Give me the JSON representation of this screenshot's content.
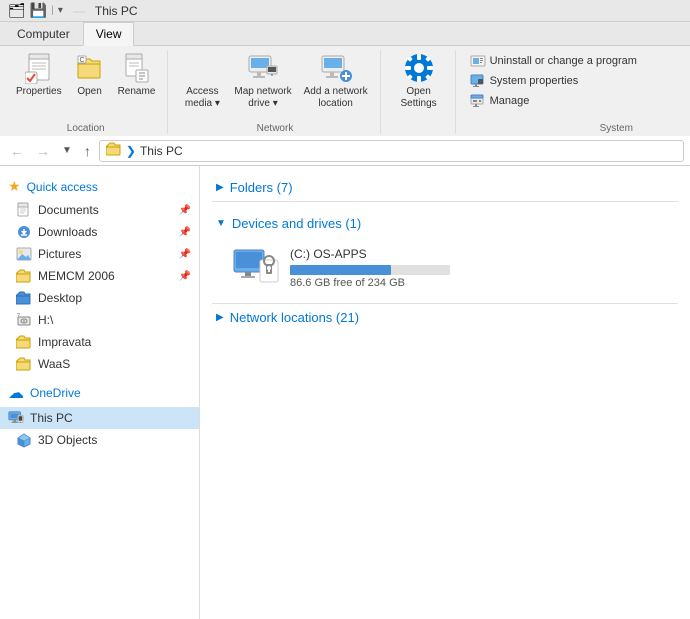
{
  "titleBar": {
    "title": "This PC",
    "icons": [
      "file-icon",
      "drive-icon"
    ]
  },
  "ribbon": {
    "tabs": [
      "Computer",
      "View"
    ],
    "activeTab": "Computer",
    "groups": {
      "location": {
        "label": "Location",
        "buttons": [
          {
            "id": "properties",
            "label": "Properties",
            "icon": "✔"
          },
          {
            "id": "open",
            "label": "Open",
            "icon": "📁"
          },
          {
            "id": "rename",
            "label": "Rename",
            "icon": "✏"
          }
        ]
      },
      "network": {
        "label": "Network",
        "buttons": [
          {
            "id": "access-media",
            "label": "Access\nmedia ▾",
            "icon": "💿"
          },
          {
            "id": "map-network-drive",
            "label": "Map network\ndrive ▾",
            "icon": "🖥"
          },
          {
            "id": "add-network-location",
            "label": "Add a network\nlocation",
            "icon": "🖥"
          }
        ]
      },
      "openSettings": {
        "label": "",
        "buttons": [
          {
            "id": "open-settings",
            "label": "Open\nSettings",
            "icon": "⚙"
          }
        ]
      },
      "system": {
        "label": "System",
        "items": [
          {
            "id": "uninstall",
            "label": "Uninstall or change a program",
            "icon": "📊"
          },
          {
            "id": "system-props",
            "label": "System properties",
            "icon": "🖥"
          },
          {
            "id": "manage",
            "label": "Manage",
            "icon": "🖥"
          }
        ]
      }
    }
  },
  "addressBar": {
    "backEnabled": false,
    "forwardEnabled": false,
    "upEnabled": true,
    "path": [
      "This PC"
    ]
  },
  "sidebar": {
    "sections": [
      {
        "id": "quick-access",
        "label": "Quick access",
        "icon": "⭐",
        "items": [
          {
            "id": "documents",
            "label": "Documents",
            "icon": "doc",
            "pinned": true
          },
          {
            "id": "downloads",
            "label": "Downloads",
            "icon": "dl",
            "pinned": true
          },
          {
            "id": "pictures",
            "label": "Pictures",
            "icon": "pic",
            "pinned": true
          },
          {
            "id": "memcm",
            "label": "MEMCM 2006",
            "icon": "folder",
            "pinned": true
          },
          {
            "id": "desktop",
            "label": "Desktop",
            "icon": "folder-blue"
          },
          {
            "id": "h-drive",
            "label": "H:\\",
            "icon": "h-drive"
          },
          {
            "id": "impravata",
            "label": "Impravata",
            "icon": "folder"
          },
          {
            "id": "waas",
            "label": "WaaS",
            "icon": "folder"
          }
        ]
      },
      {
        "id": "onedrive",
        "label": "OneDrive",
        "icon": "☁"
      },
      {
        "id": "this-pc",
        "label": "This PC",
        "icon": "pc",
        "selected": true
      },
      {
        "id": "3d-objects",
        "label": "3D Objects",
        "icon": "3d"
      }
    ]
  },
  "content": {
    "sections": [
      {
        "id": "folders",
        "title": "Folders (7)",
        "collapsed": true,
        "toggleIcon": "▶"
      },
      {
        "id": "devices",
        "title": "Devices and drives (1)",
        "collapsed": false,
        "toggleIcon": "▼",
        "drives": [
          {
            "id": "c-drive",
            "name": "(C:) OS-APPS",
            "freeSpace": "86.6 GB free of 234 GB",
            "usedPercent": 63
          }
        ]
      },
      {
        "id": "network",
        "title": "Network locations (21)",
        "collapsed": true,
        "toggleIcon": "▶"
      }
    ]
  }
}
